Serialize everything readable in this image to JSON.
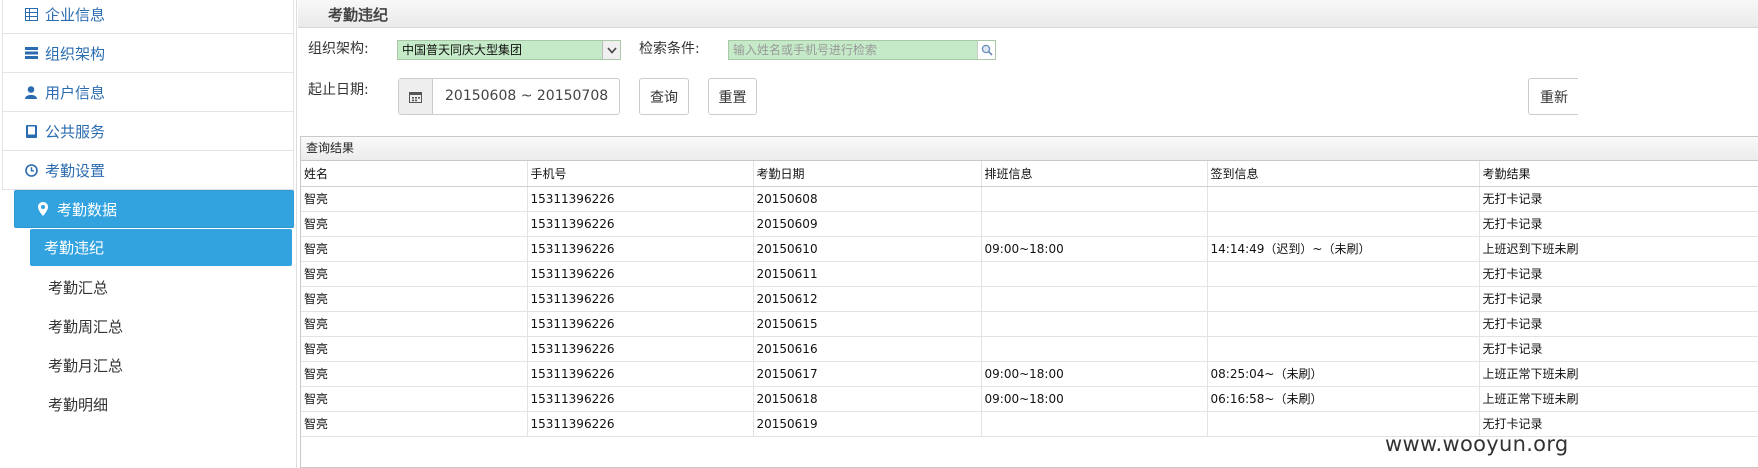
{
  "sidebar": {
    "items": [
      {
        "label": "企业信息",
        "icon": "table-icon"
      },
      {
        "label": "组织架构",
        "icon": "list-icon"
      },
      {
        "label": "用户信息",
        "icon": "user-icon"
      },
      {
        "label": "公共服务",
        "icon": "book-icon"
      },
      {
        "label": "考勤设置",
        "icon": "clock-icon"
      },
      {
        "label": "考勤数据",
        "icon": "map-marker-icon"
      }
    ],
    "sub_items": [
      {
        "label": "考勤违纪"
      },
      {
        "label": "考勤汇总"
      },
      {
        "label": "考勤周汇总"
      },
      {
        "label": "考勤月汇总"
      },
      {
        "label": "考勤明细"
      }
    ]
  },
  "page": {
    "title": "考勤违纪"
  },
  "filters": {
    "org_label": "组织架构:",
    "org_value": "中国普天同庆大型集团",
    "search_label": "检索条件:",
    "search_placeholder": "输入姓名或手机号进行检索",
    "date_label": "起止日期:",
    "date_value": "20150608 ~ 20150708",
    "query_button": "查询",
    "reset_button": "重置",
    "resync_button": "重新"
  },
  "results": {
    "title": "查询结果",
    "columns": [
      "姓名",
      "手机号",
      "考勤日期",
      "排班信息",
      "签到信息",
      "考勤结果"
    ],
    "rows": [
      [
        "智亮",
        "15311396226",
        "20150608",
        "",
        "",
        "无打卡记录"
      ],
      [
        "智亮",
        "15311396226",
        "20150609",
        "",
        "",
        "无打卡记录"
      ],
      [
        "智亮",
        "15311396226",
        "20150610",
        "09:00~18:00",
        "14:14:49（迟到）~（未刷）",
        "上班迟到下班未刷"
      ],
      [
        "智亮",
        "15311396226",
        "20150611",
        "",
        "",
        "无打卡记录"
      ],
      [
        "智亮",
        "15311396226",
        "20150612",
        "",
        "",
        "无打卡记录"
      ],
      [
        "智亮",
        "15311396226",
        "20150615",
        "",
        "",
        "无打卡记录"
      ],
      [
        "智亮",
        "15311396226",
        "20150616",
        "",
        "",
        "无打卡记录"
      ],
      [
        "智亮",
        "15311396226",
        "20150617",
        "09:00~18:00",
        "08:25:04~（未刷）",
        "上班正常下班未刷"
      ],
      [
        "智亮",
        "15311396226",
        "20150618",
        "09:00~18:00",
        "06:16:58~（未刷）",
        "上班正常下班未刷"
      ],
      [
        "智亮",
        "15311396226",
        "20150619",
        "",
        "",
        "无打卡记录"
      ]
    ]
  },
  "watermark": "www.wooyun.org",
  "colors": {
    "accent": "#33a3e0",
    "input_highlight": "#c5eac7",
    "link": "#2b6cb0"
  }
}
